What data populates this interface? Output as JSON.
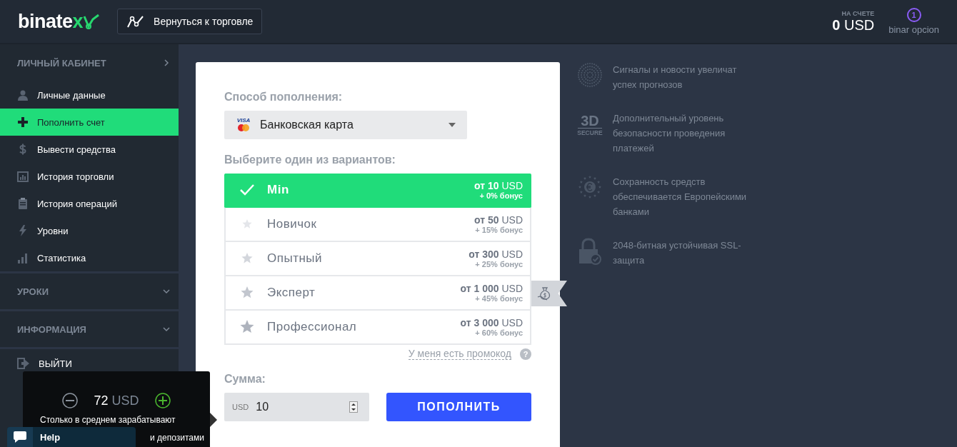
{
  "header": {
    "logo": {
      "text": "binate",
      "accent": "x"
    },
    "back_button": "Вернуться к торговле",
    "balance": {
      "label": "НА СЧЕТЕ",
      "amount": "0",
      "currency": "USD"
    },
    "user": {
      "badge": "1",
      "name": "binar opcion"
    }
  },
  "sidebar": {
    "sections": [
      {
        "title": "ЛИЧНЫЙ КАБИНЕТ",
        "expanded": true,
        "items": [
          {
            "label": "Личные данные",
            "selected": false
          },
          {
            "label": "Пополнить счет",
            "selected": true
          },
          {
            "label": "Вывести средства",
            "selected": false
          },
          {
            "label": "История торговли",
            "selected": false
          },
          {
            "label": "История операций",
            "selected": false
          },
          {
            "label": "Уровни",
            "selected": false
          },
          {
            "label": "Статистика",
            "selected": false
          }
        ]
      },
      {
        "title": "УРОКИ",
        "expanded": false
      },
      {
        "title": "ИНФОРМАЦИЯ",
        "expanded": false
      }
    ],
    "logout": "ВЫЙТИ"
  },
  "deposit": {
    "method_label": "Способ пополнения:",
    "method": "Банковская карта",
    "card_logo": "VISA",
    "options_label": "Выберите один из вариантов:",
    "options": [
      {
        "name": "Min",
        "from": "от 10",
        "currency": "USD",
        "bonus": "+ 0% бонус",
        "selected": true
      },
      {
        "name": "Новичок",
        "from": "от 50",
        "currency": "USD",
        "bonus": "+ 15% бонус",
        "selected": false,
        "color": "#e4e6ea"
      },
      {
        "name": "Опытный",
        "from": "от 300",
        "currency": "USD",
        "bonus": "+ 25% бонус",
        "selected": false,
        "color": "#d3d6dc"
      },
      {
        "name": "Эксперт",
        "from": "от 1 000",
        "currency": "USD",
        "bonus": "+ 45% бонус",
        "selected": false,
        "color": "#c2c6ce",
        "ribbon": true
      },
      {
        "name": "Профессионал",
        "from": "от 3 000",
        "currency": "USD",
        "bonus": "+ 60% бонус",
        "selected": false,
        "color": "#aeb3bd"
      }
    ],
    "promo_link": "У меня есть промокод",
    "help_mark": "?",
    "amount_label": "Сумма:",
    "amount_currency": "USD",
    "amount": "10",
    "submit": "ПОПОЛНИТЬ"
  },
  "features": [
    {
      "text": "Сигналы и новости увеличат успех прогнозов"
    },
    {
      "text": "Дополнительный уровень безопасности проведения платежей",
      "icon_text": "3D",
      "icon_sub": "SECURE"
    },
    {
      "text": "Сохранность средств обеспечивается Европейскими банками"
    },
    {
      "text": "2048-битная устойчивая SSL-защита"
    }
  ],
  "earnings_tooltip": {
    "amount": "72",
    "currency": "USD",
    "line_1": "Столько в среднем зарабатывают",
    "line_2": "и депозитами"
  },
  "chat": {
    "label": "Help"
  }
}
